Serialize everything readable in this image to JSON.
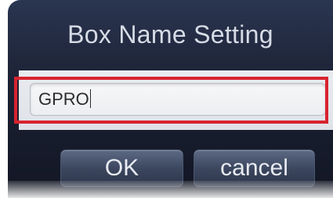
{
  "dialog": {
    "title": "Box Name Setting",
    "name_field": {
      "value": "GPRO"
    },
    "ok_label": "OK",
    "cancel_label": "cancel"
  },
  "colors": {
    "dialog_background": "#1b2133",
    "title_text": "#d6dbe6",
    "highlight_frame": "#d8232f",
    "button_text": "#e8ebf1"
  }
}
